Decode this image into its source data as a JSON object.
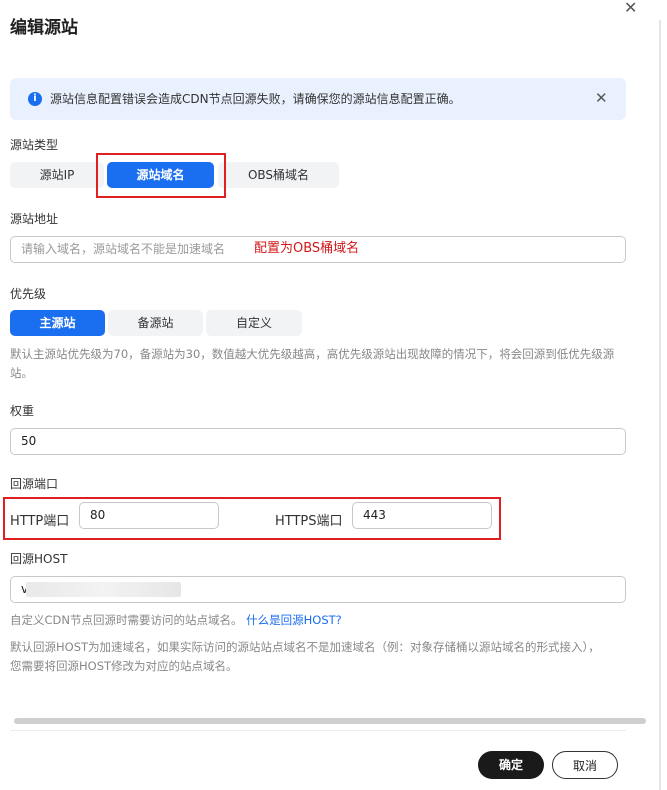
{
  "dialog": {
    "title": "编辑源站"
  },
  "alert": {
    "text": "源站信息配置错误会造成CDN节点回源失败，请确保您的源站信息配置正确。"
  },
  "origin_type": {
    "label": "源站类型",
    "options": [
      "源站IP",
      "源站域名",
      "OBS桶域名"
    ],
    "selected": "源站域名"
  },
  "origin_address": {
    "label": "源站地址",
    "placeholder": "请输入域名，源站域名不能是加速域名",
    "annotation": "配置为OBS桶域名"
  },
  "priority": {
    "label": "优先级",
    "options": [
      "主源站",
      "备源站",
      "自定义"
    ],
    "selected": "主源站",
    "hint": "默认主源站优先级为70，备源站为30，数值越大优先级越高，高优先级源站出现故障的情况下，将会回源到低优先级源站。"
  },
  "weight": {
    "label": "权重",
    "value": "50"
  },
  "origin_port": {
    "label": "回源端口",
    "http_label": "HTTP端口",
    "http_value": "80",
    "https_label": "HTTPS端口",
    "https_value": "443"
  },
  "origin_host": {
    "label": "回源HOST",
    "value": "v",
    "hint_prefix": "自定义CDN节点回源时需要访问的站点域名。",
    "hint_link": "什么是回源HOST?",
    "note": "默认回源HOST为加速域名，如果实际访问的源站站点域名不是加速域名（例：对象存储桶以源站域名的形式接入），您需要将回源HOST修改为对应的站点域名。"
  },
  "footer": {
    "confirm": "确定",
    "cancel": "取消"
  },
  "colors": {
    "primary": "#1a6ef0",
    "alert_bg": "#e8f1fd",
    "highlight": "#e02020",
    "confirm_bg": "#1a1a1a"
  },
  "icons": {
    "alert": "info-circle-icon",
    "close": "close-icon"
  }
}
